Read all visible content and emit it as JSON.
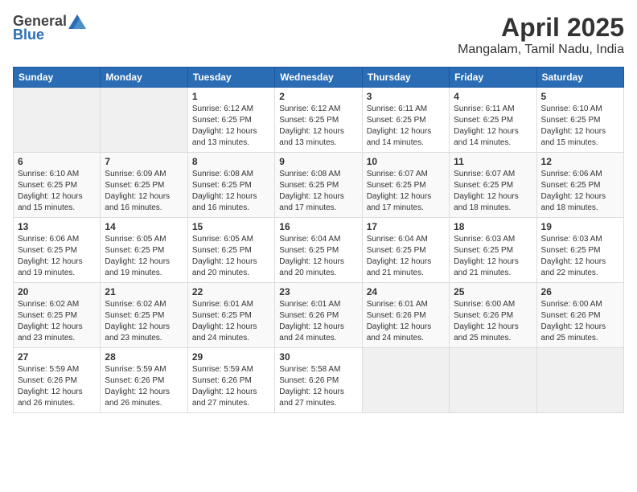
{
  "logo": {
    "general": "General",
    "blue": "Blue"
  },
  "title": {
    "month": "April 2025",
    "location": "Mangalam, Tamil Nadu, India"
  },
  "weekdays": [
    "Sunday",
    "Monday",
    "Tuesday",
    "Wednesday",
    "Thursday",
    "Friday",
    "Saturday"
  ],
  "weeks": [
    [
      {
        "day": "",
        "info": ""
      },
      {
        "day": "",
        "info": ""
      },
      {
        "day": "1",
        "info": "Sunrise: 6:12 AM\nSunset: 6:25 PM\nDaylight: 12 hours and 13 minutes."
      },
      {
        "day": "2",
        "info": "Sunrise: 6:12 AM\nSunset: 6:25 PM\nDaylight: 12 hours and 13 minutes."
      },
      {
        "day": "3",
        "info": "Sunrise: 6:11 AM\nSunset: 6:25 PM\nDaylight: 12 hours and 14 minutes."
      },
      {
        "day": "4",
        "info": "Sunrise: 6:11 AM\nSunset: 6:25 PM\nDaylight: 12 hours and 14 minutes."
      },
      {
        "day": "5",
        "info": "Sunrise: 6:10 AM\nSunset: 6:25 PM\nDaylight: 12 hours and 15 minutes."
      }
    ],
    [
      {
        "day": "6",
        "info": "Sunrise: 6:10 AM\nSunset: 6:25 PM\nDaylight: 12 hours and 15 minutes."
      },
      {
        "day": "7",
        "info": "Sunrise: 6:09 AM\nSunset: 6:25 PM\nDaylight: 12 hours and 16 minutes."
      },
      {
        "day": "8",
        "info": "Sunrise: 6:08 AM\nSunset: 6:25 PM\nDaylight: 12 hours and 16 minutes."
      },
      {
        "day": "9",
        "info": "Sunrise: 6:08 AM\nSunset: 6:25 PM\nDaylight: 12 hours and 17 minutes."
      },
      {
        "day": "10",
        "info": "Sunrise: 6:07 AM\nSunset: 6:25 PM\nDaylight: 12 hours and 17 minutes."
      },
      {
        "day": "11",
        "info": "Sunrise: 6:07 AM\nSunset: 6:25 PM\nDaylight: 12 hours and 18 minutes."
      },
      {
        "day": "12",
        "info": "Sunrise: 6:06 AM\nSunset: 6:25 PM\nDaylight: 12 hours and 18 minutes."
      }
    ],
    [
      {
        "day": "13",
        "info": "Sunrise: 6:06 AM\nSunset: 6:25 PM\nDaylight: 12 hours and 19 minutes."
      },
      {
        "day": "14",
        "info": "Sunrise: 6:05 AM\nSunset: 6:25 PM\nDaylight: 12 hours and 19 minutes."
      },
      {
        "day": "15",
        "info": "Sunrise: 6:05 AM\nSunset: 6:25 PM\nDaylight: 12 hours and 20 minutes."
      },
      {
        "day": "16",
        "info": "Sunrise: 6:04 AM\nSunset: 6:25 PM\nDaylight: 12 hours and 20 minutes."
      },
      {
        "day": "17",
        "info": "Sunrise: 6:04 AM\nSunset: 6:25 PM\nDaylight: 12 hours and 21 minutes."
      },
      {
        "day": "18",
        "info": "Sunrise: 6:03 AM\nSunset: 6:25 PM\nDaylight: 12 hours and 21 minutes."
      },
      {
        "day": "19",
        "info": "Sunrise: 6:03 AM\nSunset: 6:25 PM\nDaylight: 12 hours and 22 minutes."
      }
    ],
    [
      {
        "day": "20",
        "info": "Sunrise: 6:02 AM\nSunset: 6:25 PM\nDaylight: 12 hours and 23 minutes."
      },
      {
        "day": "21",
        "info": "Sunrise: 6:02 AM\nSunset: 6:25 PM\nDaylight: 12 hours and 23 minutes."
      },
      {
        "day": "22",
        "info": "Sunrise: 6:01 AM\nSunset: 6:25 PM\nDaylight: 12 hours and 24 minutes."
      },
      {
        "day": "23",
        "info": "Sunrise: 6:01 AM\nSunset: 6:26 PM\nDaylight: 12 hours and 24 minutes."
      },
      {
        "day": "24",
        "info": "Sunrise: 6:01 AM\nSunset: 6:26 PM\nDaylight: 12 hours and 24 minutes."
      },
      {
        "day": "25",
        "info": "Sunrise: 6:00 AM\nSunset: 6:26 PM\nDaylight: 12 hours and 25 minutes."
      },
      {
        "day": "26",
        "info": "Sunrise: 6:00 AM\nSunset: 6:26 PM\nDaylight: 12 hours and 25 minutes."
      }
    ],
    [
      {
        "day": "27",
        "info": "Sunrise: 5:59 AM\nSunset: 6:26 PM\nDaylight: 12 hours and 26 minutes."
      },
      {
        "day": "28",
        "info": "Sunrise: 5:59 AM\nSunset: 6:26 PM\nDaylight: 12 hours and 26 minutes."
      },
      {
        "day": "29",
        "info": "Sunrise: 5:59 AM\nSunset: 6:26 PM\nDaylight: 12 hours and 27 minutes."
      },
      {
        "day": "30",
        "info": "Sunrise: 5:58 AM\nSunset: 6:26 PM\nDaylight: 12 hours and 27 minutes."
      },
      {
        "day": "",
        "info": ""
      },
      {
        "day": "",
        "info": ""
      },
      {
        "day": "",
        "info": ""
      }
    ]
  ]
}
